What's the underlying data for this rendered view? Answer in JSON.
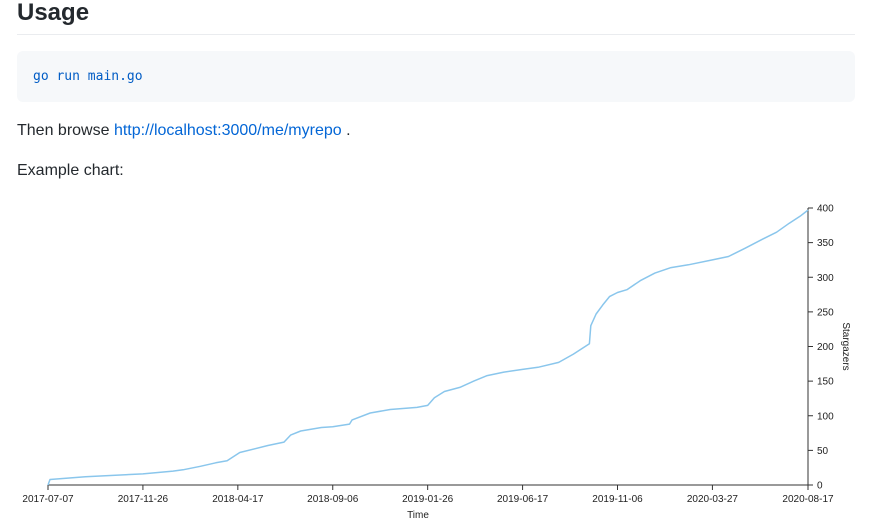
{
  "heading": "Usage",
  "code": "go run main.go",
  "browse": {
    "prefix": "Then browse",
    "link": "http://localhost:3000/me/myrepo",
    "suffix": "."
  },
  "example_label": "Example chart:",
  "chart_data": {
    "type": "line",
    "xlabel": "Time",
    "ylabel": "Stargazers",
    "x_ticks": [
      "2017-07-07",
      "2017-11-26",
      "2018-04-17",
      "2018-09-06",
      "2019-01-26",
      "2019-06-17",
      "2019-11-06",
      "2020-03-27",
      "2020-08-17"
    ],
    "y_ticks": [
      0,
      50,
      100,
      150,
      200,
      250,
      300,
      350,
      400
    ],
    "xlim": [
      "2017-07-07",
      "2020-08-17"
    ],
    "ylim": [
      0,
      400
    ],
    "grid": false,
    "color": "#8ac6ec",
    "series": [
      {
        "x": [
          "2017-07-07",
          "2017-07-10",
          "2017-09-01",
          "2017-11-26",
          "2018-01-10",
          "2018-01-25",
          "2018-02-20",
          "2018-03-15",
          "2018-04-01",
          "2018-04-20",
          "2018-06-01",
          "2018-06-25",
          "2018-07-05",
          "2018-07-20",
          "2018-08-20",
          "2018-09-06",
          "2018-10-01",
          "2018-10-05",
          "2018-11-01",
          "2018-12-01",
          "2019-01-10",
          "2019-01-26",
          "2019-02-05",
          "2019-02-20",
          "2019-03-15",
          "2019-04-05",
          "2019-04-25",
          "2019-05-20",
          "2019-06-17",
          "2019-07-10",
          "2019-08-10",
          "2019-09-01",
          "2019-09-25",
          "2019-09-27",
          "2019-10-05",
          "2019-10-15",
          "2019-10-25",
          "2019-11-06",
          "2019-11-20",
          "2019-12-10",
          "2020-01-01",
          "2020-01-25",
          "2020-02-20",
          "2020-03-27",
          "2020-04-20",
          "2020-05-15",
          "2020-06-10",
          "2020-07-01",
          "2020-07-20",
          "2020-08-05",
          "2020-08-17"
        ],
        "y": [
          0,
          8,
          12,
          16,
          20,
          22,
          27,
          32,
          35,
          47,
          57,
          62,
          72,
          78,
          83,
          84,
          88,
          94,
          104,
          109,
          112,
          115,
          126,
          135,
          141,
          150,
          158,
          163,
          167,
          170,
          177,
          189,
          204,
          230,
          247,
          260,
          272,
          278,
          282,
          295,
          306,
          314,
          318,
          325,
          330,
          342,
          355,
          365,
          378,
          388,
          397
        ]
      }
    ]
  }
}
